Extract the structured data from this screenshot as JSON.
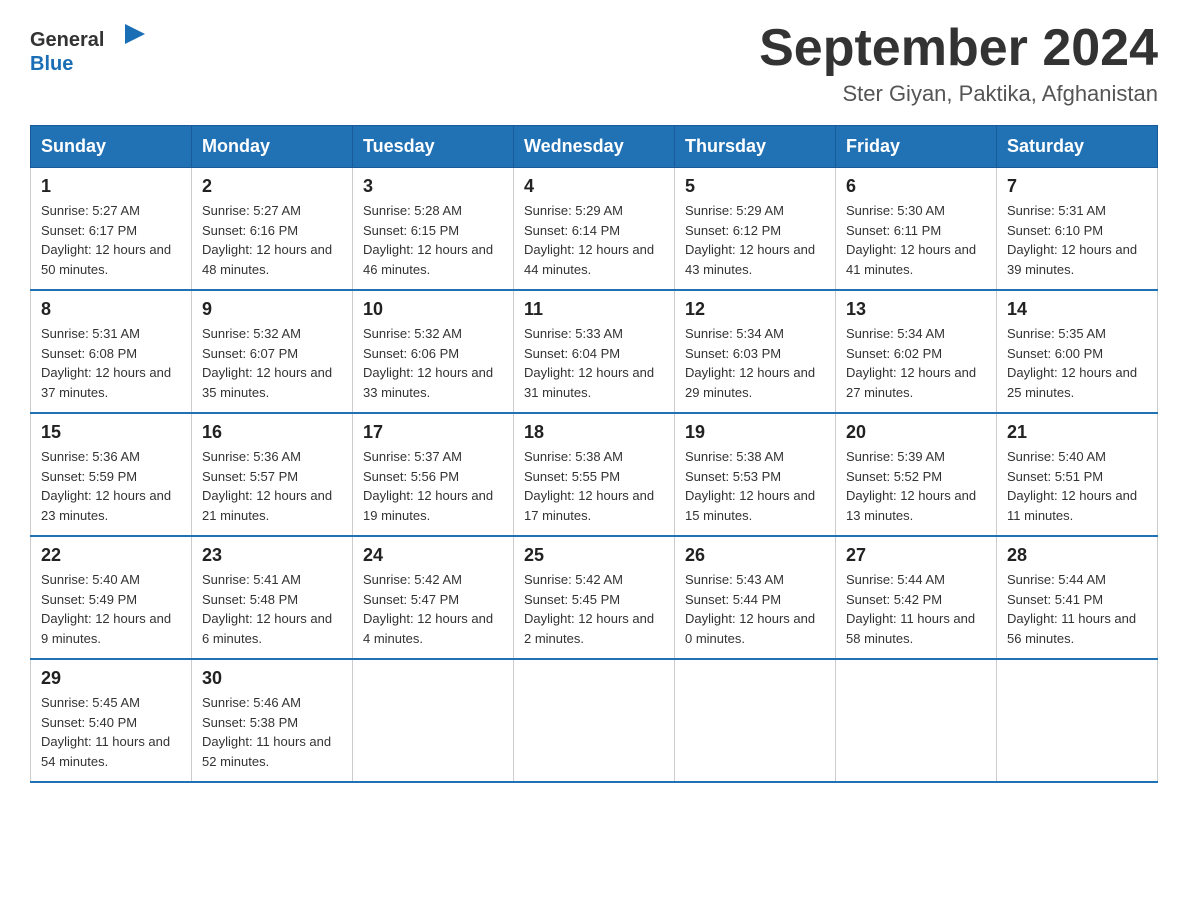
{
  "header": {
    "logo_general": "General",
    "logo_blue": "Blue",
    "title": "September 2024",
    "subtitle": "Ster Giyan, Paktika, Afghanistan"
  },
  "weekdays": [
    "Sunday",
    "Monday",
    "Tuesday",
    "Wednesday",
    "Thursday",
    "Friday",
    "Saturday"
  ],
  "weeks": [
    [
      {
        "day": "1",
        "sunrise": "5:27 AM",
        "sunset": "6:17 PM",
        "daylight": "12 hours and 50 minutes."
      },
      {
        "day": "2",
        "sunrise": "5:27 AM",
        "sunset": "6:16 PM",
        "daylight": "12 hours and 48 minutes."
      },
      {
        "day": "3",
        "sunrise": "5:28 AM",
        "sunset": "6:15 PM",
        "daylight": "12 hours and 46 minutes."
      },
      {
        "day": "4",
        "sunrise": "5:29 AM",
        "sunset": "6:14 PM",
        "daylight": "12 hours and 44 minutes."
      },
      {
        "day": "5",
        "sunrise": "5:29 AM",
        "sunset": "6:12 PM",
        "daylight": "12 hours and 43 minutes."
      },
      {
        "day": "6",
        "sunrise": "5:30 AM",
        "sunset": "6:11 PM",
        "daylight": "12 hours and 41 minutes."
      },
      {
        "day": "7",
        "sunrise": "5:31 AM",
        "sunset": "6:10 PM",
        "daylight": "12 hours and 39 minutes."
      }
    ],
    [
      {
        "day": "8",
        "sunrise": "5:31 AM",
        "sunset": "6:08 PM",
        "daylight": "12 hours and 37 minutes."
      },
      {
        "day": "9",
        "sunrise": "5:32 AM",
        "sunset": "6:07 PM",
        "daylight": "12 hours and 35 minutes."
      },
      {
        "day": "10",
        "sunrise": "5:32 AM",
        "sunset": "6:06 PM",
        "daylight": "12 hours and 33 minutes."
      },
      {
        "day": "11",
        "sunrise": "5:33 AM",
        "sunset": "6:04 PM",
        "daylight": "12 hours and 31 minutes."
      },
      {
        "day": "12",
        "sunrise": "5:34 AM",
        "sunset": "6:03 PM",
        "daylight": "12 hours and 29 minutes."
      },
      {
        "day": "13",
        "sunrise": "5:34 AM",
        "sunset": "6:02 PM",
        "daylight": "12 hours and 27 minutes."
      },
      {
        "day": "14",
        "sunrise": "5:35 AM",
        "sunset": "6:00 PM",
        "daylight": "12 hours and 25 minutes."
      }
    ],
    [
      {
        "day": "15",
        "sunrise": "5:36 AM",
        "sunset": "5:59 PM",
        "daylight": "12 hours and 23 minutes."
      },
      {
        "day": "16",
        "sunrise": "5:36 AM",
        "sunset": "5:57 PM",
        "daylight": "12 hours and 21 minutes."
      },
      {
        "day": "17",
        "sunrise": "5:37 AM",
        "sunset": "5:56 PM",
        "daylight": "12 hours and 19 minutes."
      },
      {
        "day": "18",
        "sunrise": "5:38 AM",
        "sunset": "5:55 PM",
        "daylight": "12 hours and 17 minutes."
      },
      {
        "day": "19",
        "sunrise": "5:38 AM",
        "sunset": "5:53 PM",
        "daylight": "12 hours and 15 minutes."
      },
      {
        "day": "20",
        "sunrise": "5:39 AM",
        "sunset": "5:52 PM",
        "daylight": "12 hours and 13 minutes."
      },
      {
        "day": "21",
        "sunrise": "5:40 AM",
        "sunset": "5:51 PM",
        "daylight": "12 hours and 11 minutes."
      }
    ],
    [
      {
        "day": "22",
        "sunrise": "5:40 AM",
        "sunset": "5:49 PM",
        "daylight": "12 hours and 9 minutes."
      },
      {
        "day": "23",
        "sunrise": "5:41 AM",
        "sunset": "5:48 PM",
        "daylight": "12 hours and 6 minutes."
      },
      {
        "day": "24",
        "sunrise": "5:42 AM",
        "sunset": "5:47 PM",
        "daylight": "12 hours and 4 minutes."
      },
      {
        "day": "25",
        "sunrise": "5:42 AM",
        "sunset": "5:45 PM",
        "daylight": "12 hours and 2 minutes."
      },
      {
        "day": "26",
        "sunrise": "5:43 AM",
        "sunset": "5:44 PM",
        "daylight": "12 hours and 0 minutes."
      },
      {
        "day": "27",
        "sunrise": "5:44 AM",
        "sunset": "5:42 PM",
        "daylight": "11 hours and 58 minutes."
      },
      {
        "day": "28",
        "sunrise": "5:44 AM",
        "sunset": "5:41 PM",
        "daylight": "11 hours and 56 minutes."
      }
    ],
    [
      {
        "day": "29",
        "sunrise": "5:45 AM",
        "sunset": "5:40 PM",
        "daylight": "11 hours and 54 minutes."
      },
      {
        "day": "30",
        "sunrise": "5:46 AM",
        "sunset": "5:38 PM",
        "daylight": "11 hours and 52 minutes."
      },
      null,
      null,
      null,
      null,
      null
    ]
  ],
  "labels": {
    "sunrise_prefix": "Sunrise: ",
    "sunset_prefix": "Sunset: ",
    "daylight_prefix": "Daylight: "
  }
}
